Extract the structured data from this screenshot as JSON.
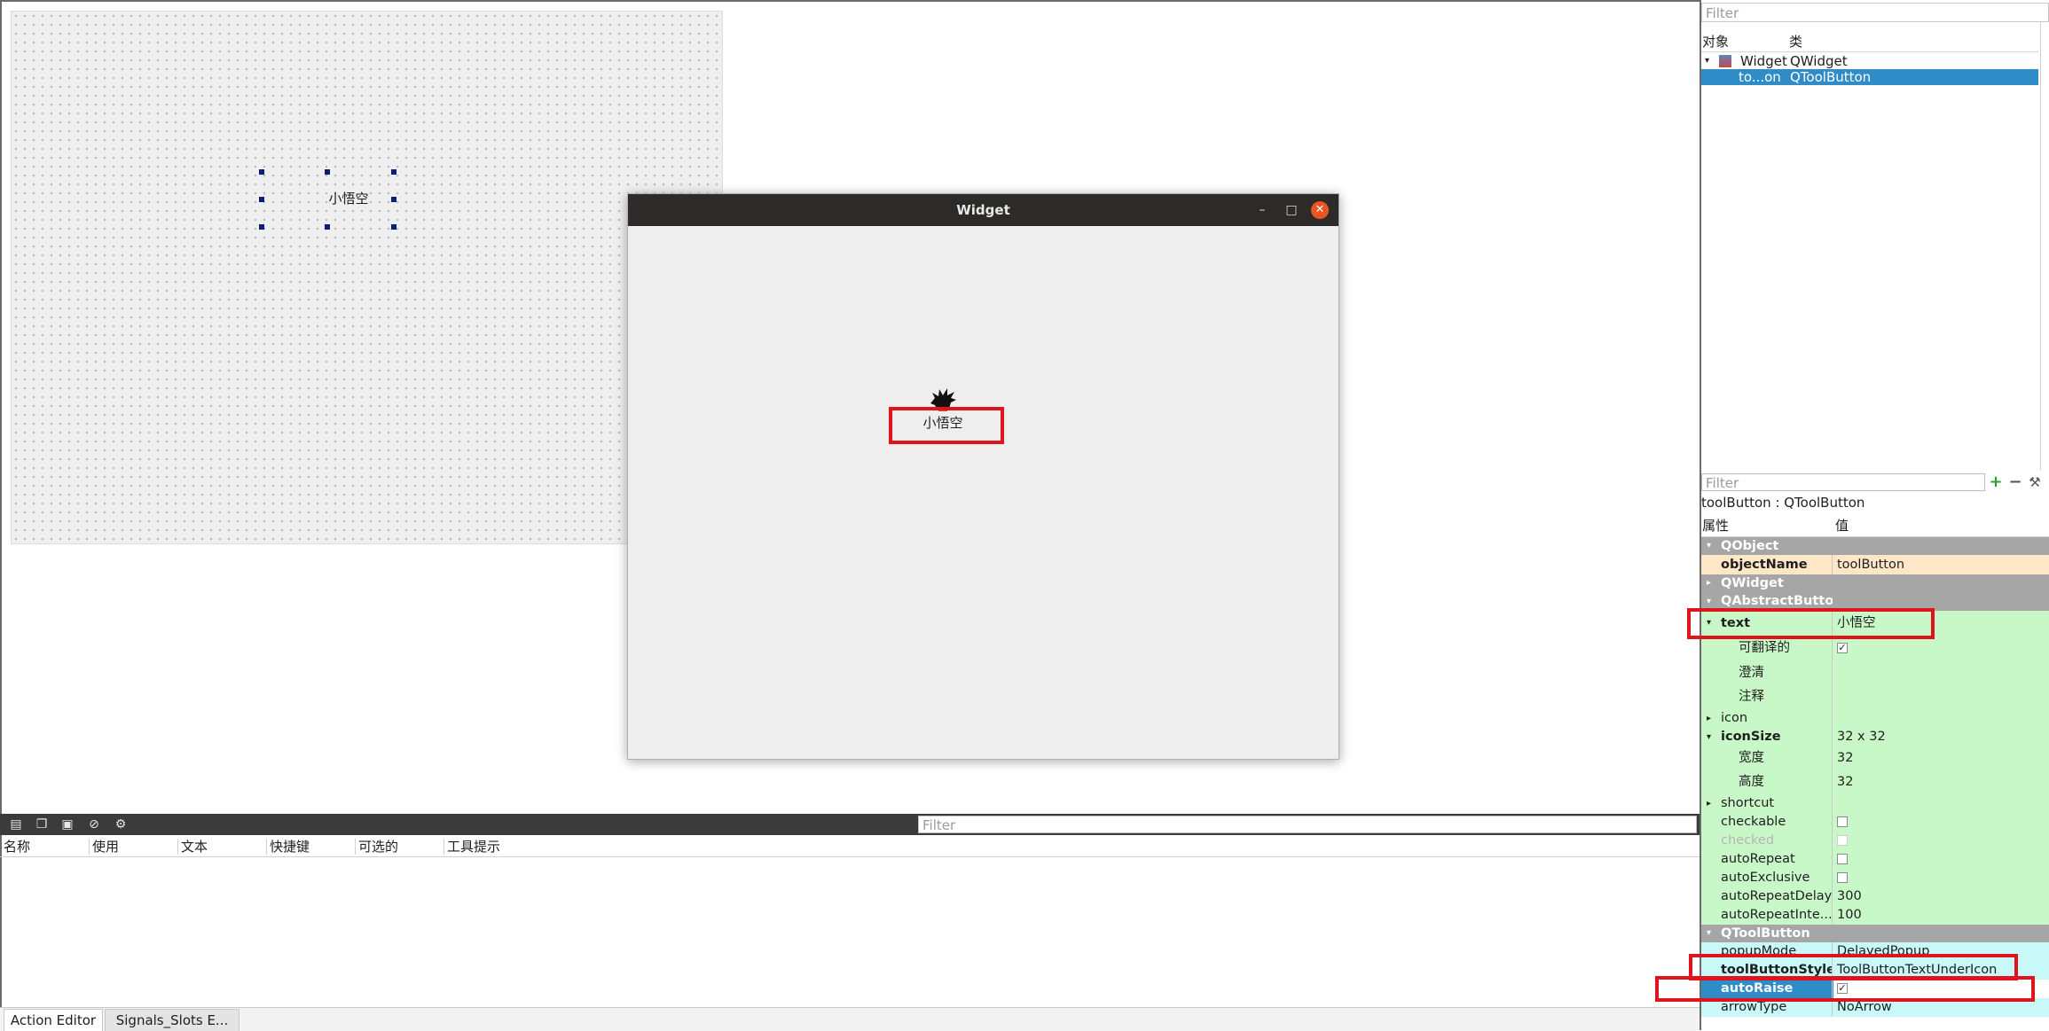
{
  "canvas": {
    "button_text": "小悟空"
  },
  "preview": {
    "title": "Widget",
    "minimize_glyph": "–",
    "maximize_glyph": "□",
    "close_glyph": "✕",
    "button_text": "小悟空"
  },
  "object_inspector": {
    "filter_placeholder": "Filter",
    "headers": {
      "object": "对象",
      "class": "类"
    },
    "rows": [
      {
        "name": "Widget",
        "class": "QWidget"
      },
      {
        "name": "to...on",
        "class": "QToolButton"
      }
    ]
  },
  "property_editor": {
    "filter_placeholder": "Filter",
    "class_label": "toolButton : QToolButton",
    "headers": {
      "property": "属性",
      "value": "值"
    },
    "add_glyph": "+",
    "remove_glyph": "−",
    "config_glyph": "⚒",
    "sections": {
      "qobject": "QObject",
      "qwidget": "QWidget",
      "qabstractbutton": "QAbstractButton",
      "qtoolbutton": "QToolButton"
    },
    "props": {
      "objectName": {
        "name": "objectName",
        "value": "toolButton"
      },
      "text": {
        "name": "text",
        "value": "小悟空"
      },
      "translatable": {
        "name": "可翻译的",
        "value": "✓"
      },
      "disambiguation": {
        "name": "澄清",
        "value": ""
      },
      "comment": {
        "name": "注释",
        "value": ""
      },
      "icon": {
        "name": "icon",
        "value": ""
      },
      "iconSize": {
        "name": "iconSize",
        "value": "32 x 32"
      },
      "width": {
        "name": "宽度",
        "value": "32"
      },
      "height": {
        "name": "高度",
        "value": "32"
      },
      "shortcut": {
        "name": "shortcut",
        "value": ""
      },
      "checkable": {
        "name": "checkable",
        "value": ""
      },
      "checked": {
        "name": "checked",
        "value": ""
      },
      "autoRepeat": {
        "name": "autoRepeat",
        "value": ""
      },
      "autoExclusive": {
        "name": "autoExclusive",
        "value": ""
      },
      "autoRepeatDelay": {
        "name": "autoRepeatDelay",
        "value": "300"
      },
      "autoRepeatInterval": {
        "name": "autoRepeatInte...",
        "value": "100"
      },
      "popupMode": {
        "name": "popupMode",
        "value": "DelayedPopup"
      },
      "toolButtonStyle": {
        "name": "toolButtonStyle",
        "value": "ToolButtonTextUnderIcon"
      },
      "autoRaise": {
        "name": "autoRaise",
        "value": "✓"
      },
      "arrowType": {
        "name": "arrowType",
        "value": "NoArrow"
      }
    }
  },
  "action_editor": {
    "filter_placeholder": "Filter",
    "columns": [
      "名称",
      "使用",
      "文本",
      "快捷键",
      "可选的",
      "工具提示"
    ],
    "toolbar_icons": [
      "new-action-icon",
      "copy-icon",
      "paste-icon",
      "delete-icon",
      "settings-icon"
    ]
  },
  "bottom_tabs": [
    "Action Editor",
    "Signals_Slots E..."
  ],
  "colors": {
    "selection": "#308cc6",
    "highlight_red": "#e0141e",
    "close_orange": "#e95420"
  }
}
